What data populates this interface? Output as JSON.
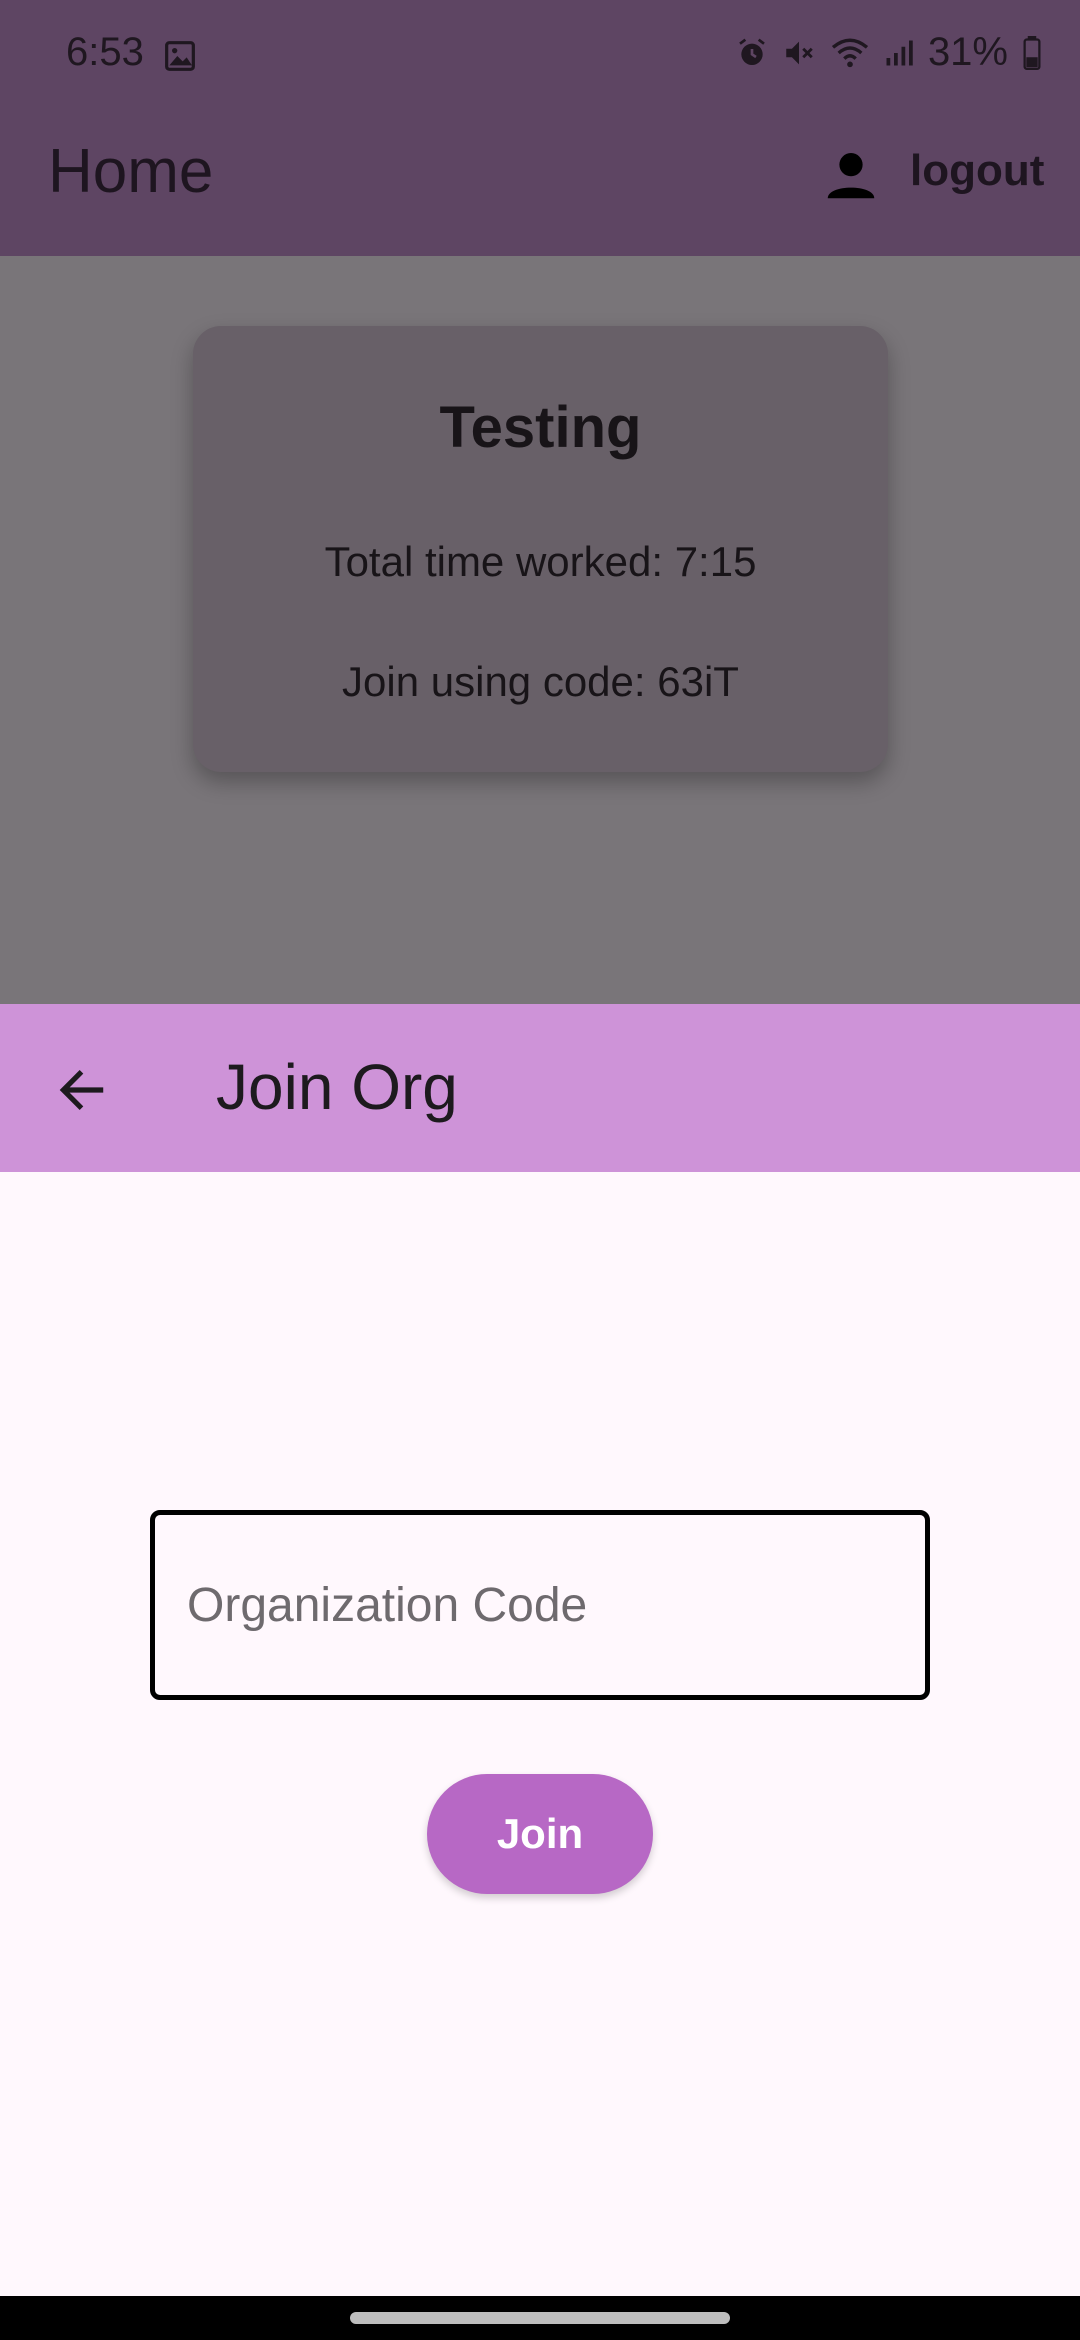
{
  "status_bar": {
    "time": "6:53",
    "battery_percent": "31%",
    "icons": [
      "image-icon",
      "alarm-icon",
      "mute-icon",
      "wifi-icon",
      "signal-icon",
      "battery-icon"
    ]
  },
  "home": {
    "title": "Home",
    "logout_label": "logout",
    "card": {
      "name": "Testing",
      "time_worked": "Total time worked: 7:15",
      "join_code": "Join using code: 63iT"
    }
  },
  "join_org": {
    "title": "Join Org",
    "code_field": {
      "placeholder": "Organization Code",
      "value": ""
    },
    "join_button_label": "Join"
  },
  "colors": {
    "home_appbar": "#5e4563",
    "scrim_body": "#797579",
    "card": "#686068",
    "join_appbar": "#ce93d8",
    "join_button": "#b768c5",
    "sheet_background": "#fff8fd"
  }
}
